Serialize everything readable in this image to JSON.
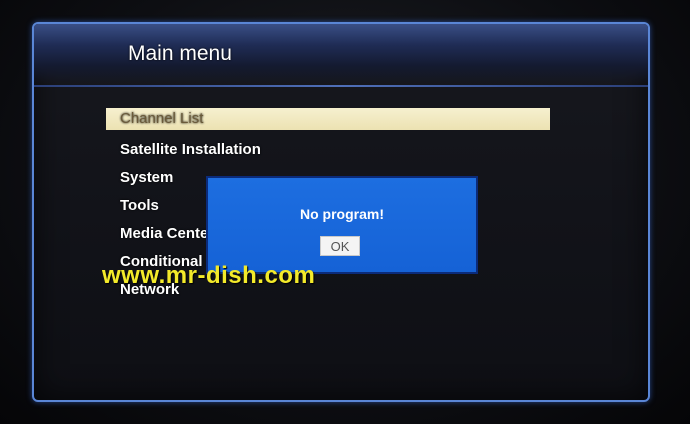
{
  "header": {
    "title": "Main menu"
  },
  "menu": {
    "items": [
      {
        "label": "Channel List",
        "selected": true
      },
      {
        "label": "Satellite Installation",
        "selected": false
      },
      {
        "label": "System",
        "selected": false
      },
      {
        "label": "Tools",
        "selected": false
      },
      {
        "label": "Media Cente",
        "selected": false
      },
      {
        "label": "Conditional",
        "selected": false
      },
      {
        "label": "Network",
        "selected": false
      }
    ]
  },
  "dialog": {
    "message": "No program!",
    "ok_label": "OK"
  },
  "watermark": {
    "text": "www.mr-dish.com"
  },
  "colors": {
    "frame_border": "#5a86d6",
    "selection_bg": "#f6f0cf",
    "dialog_bg": "#1d6ee0",
    "watermark": "#f3ea2a"
  }
}
